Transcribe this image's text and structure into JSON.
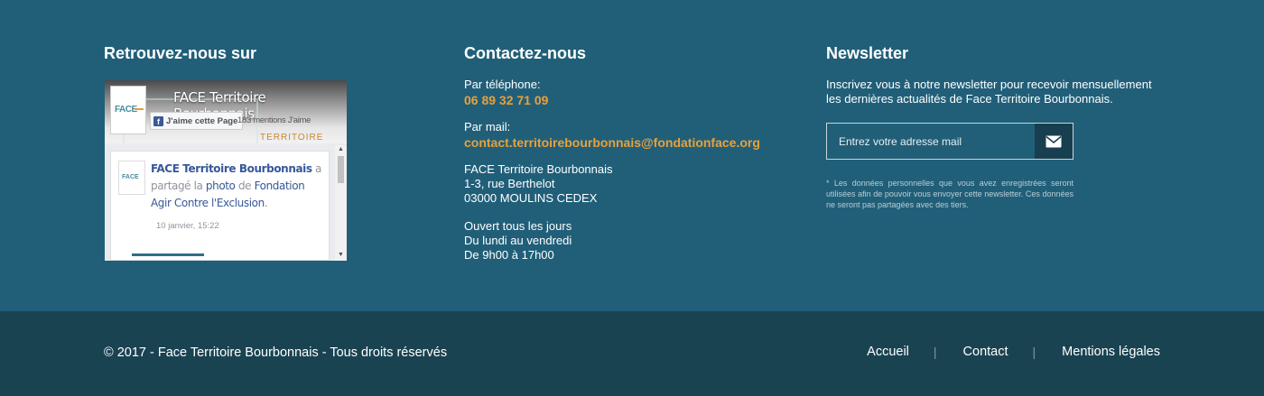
{
  "social": {
    "heading": "Retrouvez-nous sur",
    "facebook": {
      "page_name": "FACE Territoire Bourbonnais",
      "like_label": "J'aime cette Page",
      "likes_count": "183 mentions J'aime",
      "post": {
        "author": "FACE Territoire Bourbonnais",
        "shared_text": "a partagé la",
        "photo_link": "photo",
        "from_text": "de",
        "source": "Fondation Agir Contre l'Exclusion",
        "date": "10 janvier, 15:22"
      }
    }
  },
  "contact": {
    "heading": "Contactez-nous",
    "phone_label": "Par téléphone:",
    "phone": "06 89 32 71 09",
    "mail_label": "Par mail:",
    "email": "contact.territoirebourbonnais@fondationface.org",
    "address": [
      "FACE Territoire Bourbonnais",
      "1-3, rue Berthelot",
      "03000 MOULINS CEDEX"
    ],
    "hours": [
      "Ouvert tous les jours",
      "Du lundi au vendredi",
      "De 9h00 à 17h00"
    ]
  },
  "newsletter": {
    "heading": "Newsletter",
    "intro": "Inscrivez vous à notre newsletter pour recevoir mensuellement les dernières actualités de Face Territoire Bourbonnais.",
    "placeholder": "Entrez votre adresse mail",
    "submit_icon": "envelope-icon",
    "note": "* Les données personnelles que vous avez enregistrées seront utilisées afin de pouvoir vous envoyer cette newsletter. Ces données ne seront pas partagées avec des tiers."
  },
  "footer": {
    "copyright": "© 2017 - Face Territoire Bourbonnais - Tous droits réservés",
    "nav": [
      "Accueil",
      "Contact",
      "Mentions légales"
    ],
    "separator": "|"
  },
  "colors": {
    "background": "#215f79",
    "footer_background": "#1a4352",
    "accent": "#e8a13a",
    "button": "#183f4f"
  }
}
